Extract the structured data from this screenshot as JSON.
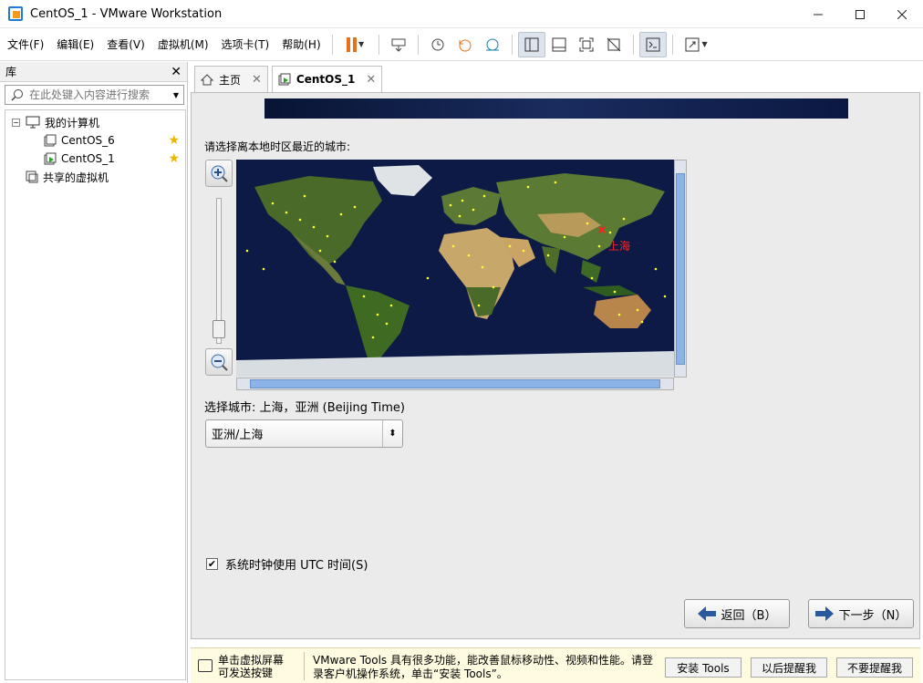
{
  "window": {
    "title": "CentOS_1 - VMware Workstation"
  },
  "menu": [
    "文件(F)",
    "编辑(E)",
    "查看(V)",
    "虚拟机(M)",
    "选项卡(T)",
    "帮助(H)"
  ],
  "library": {
    "title": "库",
    "search_placeholder": "在此处键入内容进行搜索",
    "root": "我的计算机",
    "vms": [
      "CentOS_6",
      "CentOS_1"
    ],
    "shared": "共享的虚拟机"
  },
  "tabs": {
    "home": "主页",
    "vm": "CentOS_1"
  },
  "installer": {
    "prompt": "请选择离本地时区最近的城市:",
    "map_city_label": "上海",
    "selected_city": "选择城市: 上海，亚洲 (Beijing Time)",
    "timezone_value": "亚洲/上海",
    "utc_label": "系统时钟使用 UTC 时间(S)",
    "utc_checked": true,
    "back_label": "返回（B）",
    "next_label": "下一步（N）"
  },
  "hint": {
    "left_line1": "单击虚拟屏幕",
    "left_line2": "可发送按键",
    "message": "VMware Tools 具有很多功能，能改善鼠标移动性、视频和性能。请登录客户机操作系统，单击“安装 Tools”。",
    "install_button": "安装 Tools",
    "remind_button": "以后提醒我",
    "never_button": "不要提醒我"
  },
  "colors": {
    "accent": "#e8701a",
    "map_ocean": "#0d1a46",
    "city_dot": "#ffff33",
    "selected_marker": "#ff2222",
    "scroll_thumb": "#8bb3e6"
  }
}
